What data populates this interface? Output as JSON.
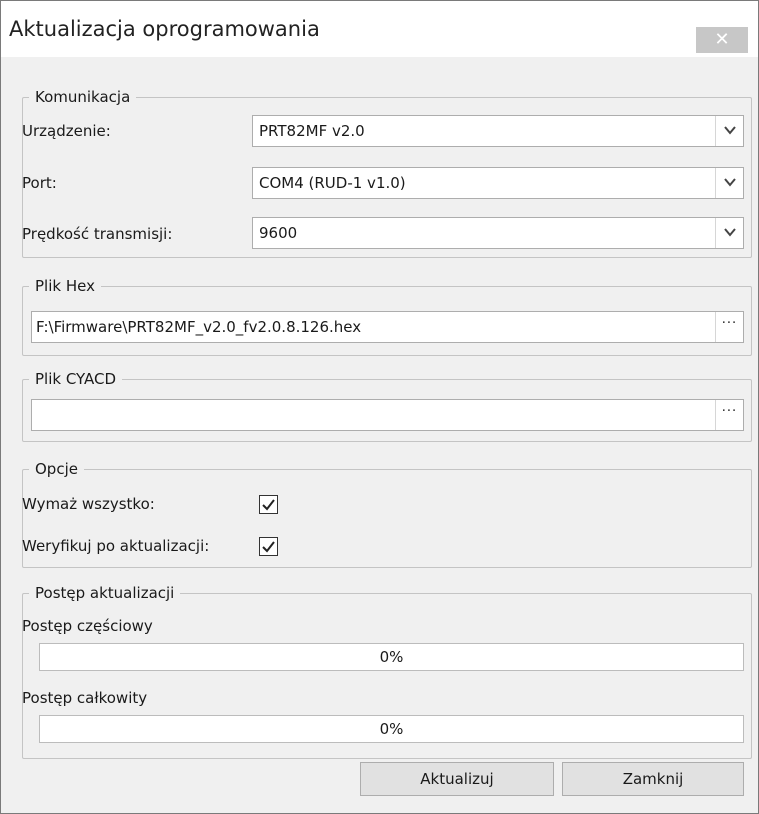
{
  "window": {
    "title": "Aktualizacja oprogramowania",
    "close_glyph": "✕"
  },
  "komunikacja": {
    "legend": "Komunikacja",
    "device_label": "Urządzenie:",
    "device_value": "PRT82MF v2.0",
    "port_label": "Port:",
    "port_value": "COM4 (RUD-1 v1.0)",
    "speed_label": "Prędkość transmisji:",
    "speed_value": "9600"
  },
  "plik_hex": {
    "legend": "Plik Hex",
    "path": "F:\\Firmware\\PRT82MF_v2.0_fv2.0.8.126.hex",
    "browse_label": "···"
  },
  "plik_cyacd": {
    "legend": "Plik CYACD",
    "path": "",
    "browse_label": "···"
  },
  "opcje": {
    "legend": "Opcje",
    "erase_label": "Wymaż wszystko:",
    "erase_checked": true,
    "verify_label": "Weryfikuj po aktualizacji:",
    "verify_checked": true
  },
  "postep": {
    "legend": "Postęp aktualizacji",
    "partial_label": "Postęp częściowy",
    "partial_value": "0%",
    "partial_fraction": 0,
    "total_label": "Postęp całkowity",
    "total_value": "0%",
    "total_fraction": 0
  },
  "buttons": {
    "update": "Aktualizuj",
    "close": "Zamknij"
  },
  "icons": {
    "dropdown": "chevron-down-icon",
    "check": "checkmark-icon",
    "close": "close-icon"
  }
}
